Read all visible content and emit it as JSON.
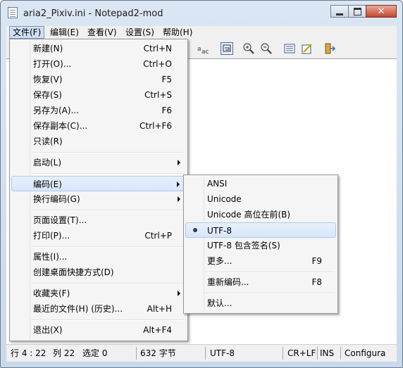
{
  "window": {
    "title": "aria2_Pixiv.ini - Notepad2-mod"
  },
  "menubar": [
    "文件(F)",
    "编辑(E)",
    "查看(V)",
    "设置(S)",
    "帮助(H)"
  ],
  "file_menu": {
    "items": [
      {
        "label": "新建(N)",
        "shortcut": "Ctrl+N"
      },
      {
        "label": "打开(O)...",
        "shortcut": "Ctrl+O"
      },
      {
        "label": "恢复(V)",
        "shortcut": "F5"
      },
      {
        "label": "保存(S)",
        "shortcut": "Ctrl+S"
      },
      {
        "label": "另存为(A)...",
        "shortcut": "F6"
      },
      {
        "label": "保存副本(C)...",
        "shortcut": "Ctrl+F6"
      },
      {
        "label": "只读(R)",
        "shortcut": ""
      },
      {
        "label": "启动(L)",
        "shortcut": ""
      },
      {
        "label": "编码(E)",
        "shortcut": ""
      },
      {
        "label": "换行编码(G)",
        "shortcut": ""
      },
      {
        "label": "页面设置(T)...",
        "shortcut": ""
      },
      {
        "label": "打印(P)...",
        "shortcut": "Ctrl+P"
      },
      {
        "label": "属性(I)...",
        "shortcut": ""
      },
      {
        "label": "创建桌面快捷方式(D)",
        "shortcut": ""
      },
      {
        "label": "收藏夹(F)",
        "shortcut": ""
      },
      {
        "label": "最近的文件(H) (历史)...",
        "shortcut": "Alt+H"
      },
      {
        "label": "退出(X)",
        "shortcut": "Alt+F4"
      }
    ]
  },
  "encoding_menu": {
    "items": [
      {
        "label": "ANSI",
        "shortcut": ""
      },
      {
        "label": "Unicode",
        "shortcut": ""
      },
      {
        "label": "Unicode 高位在前(B)",
        "shortcut": ""
      },
      {
        "label": "UTF-8",
        "shortcut": "",
        "selected": true
      },
      {
        "label": "UTF-8 包含签名(S)",
        "shortcut": ""
      },
      {
        "label": "更多...",
        "shortcut": "F9"
      },
      {
        "label": "重新编码...",
        "shortcut": "F8"
      },
      {
        "label": "默认...",
        "shortcut": ""
      }
    ]
  },
  "statusbar": {
    "position": "行 4 : 22",
    "column": "列 22",
    "selection": "选定 0",
    "size": "632 字节",
    "encoding": "UTF-8",
    "line_ending": "CR+LF",
    "insert_mode": "INS",
    "scheme": "Configura"
  },
  "toolbar_icons": [
    "find-replace-icon",
    "word-wrap-icon",
    "zoom-in-icon",
    "zoom-out-icon",
    "scheme-icon",
    "customize-scheme-icon",
    "exit-icon"
  ]
}
